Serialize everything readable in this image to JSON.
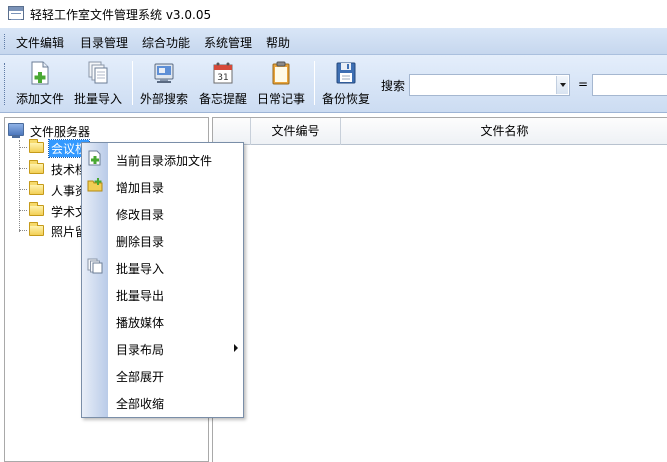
{
  "window": {
    "title": "轻轻工作室文件管理系统 v3.0.05"
  },
  "menubar": {
    "items": [
      "文件编辑",
      "目录管理",
      "综合功能",
      "系统管理",
      "帮助"
    ]
  },
  "toolbar": {
    "buttons": [
      {
        "label": "添加文件",
        "icon": "add-file-icon"
      },
      {
        "label": "批量导入",
        "icon": "batch-import-icon"
      },
      {
        "label": "外部搜索",
        "icon": "external-search-icon"
      },
      {
        "label": "备忘提醒",
        "icon": "calendar-icon"
      },
      {
        "label": "日常记事",
        "icon": "clipboard-icon"
      },
      {
        "label": "备份恢复",
        "icon": "floppy-disk-icon"
      }
    ],
    "search_label": "搜索",
    "search_value": "",
    "equals_label": "=",
    "match_value": ""
  },
  "tree": {
    "root": "文件服务器",
    "items": [
      {
        "label": "会议杈",
        "selected": true
      },
      {
        "label": "技术档",
        "selected": false
      },
      {
        "label": "人事资",
        "selected": false
      },
      {
        "label": "学术文",
        "selected": false
      },
      {
        "label": "照片留",
        "selected": false
      }
    ]
  },
  "grid": {
    "columns": [
      "",
      "文件编号",
      "文件名称"
    ]
  },
  "context_menu": {
    "items": [
      {
        "label": "当前目录添加文件",
        "icon": "add-file-icon",
        "submenu": false
      },
      {
        "label": "增加目录",
        "icon": "add-folder-icon",
        "submenu": false
      },
      {
        "label": "修改目录",
        "icon": "",
        "submenu": false
      },
      {
        "label": "删除目录",
        "icon": "",
        "submenu": false
      },
      {
        "label": "批量导入",
        "icon": "batch-import-icon",
        "submenu": false
      },
      {
        "label": "批量导出",
        "icon": "",
        "submenu": false
      },
      {
        "label": "播放媒体",
        "icon": "",
        "submenu": false
      },
      {
        "label": "目录布局",
        "icon": "",
        "submenu": true
      },
      {
        "label": "全部展开",
        "icon": "",
        "submenu": false
      },
      {
        "label": "全部收缩",
        "icon": "",
        "submenu": false
      }
    ]
  }
}
